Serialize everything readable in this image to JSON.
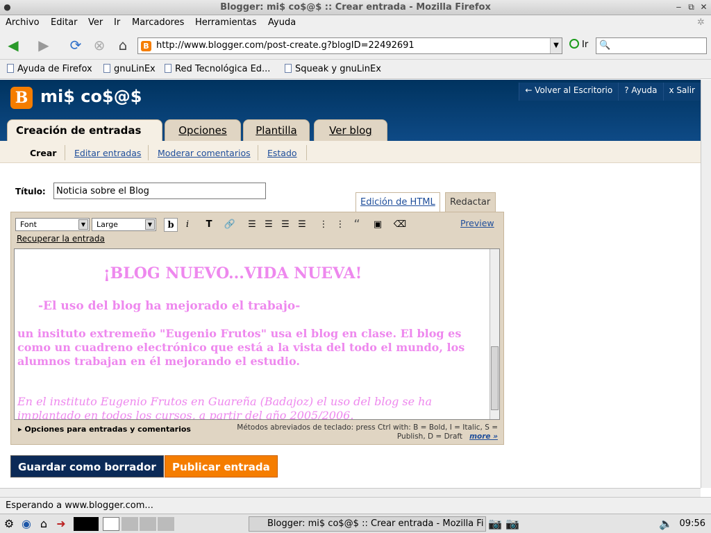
{
  "window": {
    "title": "Blogger: mi$ co$@$ :: Crear entrada - Mozilla Firefox"
  },
  "menu": [
    "Archivo",
    "Editar",
    "Ver",
    "Ir",
    "Marcadores",
    "Herramientas",
    "Ayuda"
  ],
  "nav": {
    "url": "http://www.blogger.com/post-create.g?blogID=22492691",
    "go_label": "Ir",
    "search_value": ""
  },
  "bookmarks": [
    "Ayuda de Firefox",
    "gnuLinEx",
    "Red Tecnológica Ed...",
    "Squeak y gnuLinEx"
  ],
  "blog": {
    "logo_letter": "B",
    "name": "mi$ co$@$",
    "top_links": [
      "← Volver al Escritorio",
      "? Ayuda",
      "x Salir"
    ]
  },
  "tabs": [
    "Creación de entradas",
    "Opciones",
    "Plantilla",
    "Ver blog"
  ],
  "subtabs": [
    "Crear",
    "Editar entradas",
    "Moderar comentarios",
    "Estado"
  ],
  "post": {
    "title_label": "Título:",
    "title_value": "Noticia sobre el Blog",
    "mode_html": "Edición de HTML",
    "mode_compose": "Redactar"
  },
  "toolbar": {
    "font": "Font",
    "size": "Large",
    "bold": "b",
    "italic": "i",
    "preview": "Preview",
    "recover": "Recuperar la entrada"
  },
  "body": {
    "heading": "¡BLOG NUEVO...VIDA NUEVA!",
    "subheading": "-El uso del blog ha mejorado el trabajo-",
    "para1": " un insituto extremeño \"Eugenio Frutos\" usa el blog en clase. El blog es como un cuadreno electrónico que está a la vista del todo el mundo, los alumnos trabajan en él mejorando el estudio.",
    "para2": " En el instituto Eugenio Frutos en Guareña (Badajoz) el uso del blog se ha implantado en todos los cursos, a partir del año 2005/2006."
  },
  "footer": {
    "options": "Opciones para entradas y comentarios",
    "shortcuts_line1": "Métodos abreviados de teclado: press Ctrl with: B = Bold, I = Italic, S =",
    "shortcuts_line2": "Publish, D = Draft",
    "more": "more »"
  },
  "buttons": {
    "draft": "Guardar como borrador",
    "publish": "Publicar entrada"
  },
  "status": "Esperando a www.blogger.com...",
  "taskbar": {
    "item": "Blogger: mi$ co$@$ :: Crear entrada - Mozilla Fi",
    "clock": "09:56"
  },
  "colors": {
    "blogger_orange": "#f57d00",
    "header_blue": "#003366",
    "body_pink": "#ee88ee",
    "draft_button": "#0b2a57",
    "publish_button": "#f57d00"
  }
}
